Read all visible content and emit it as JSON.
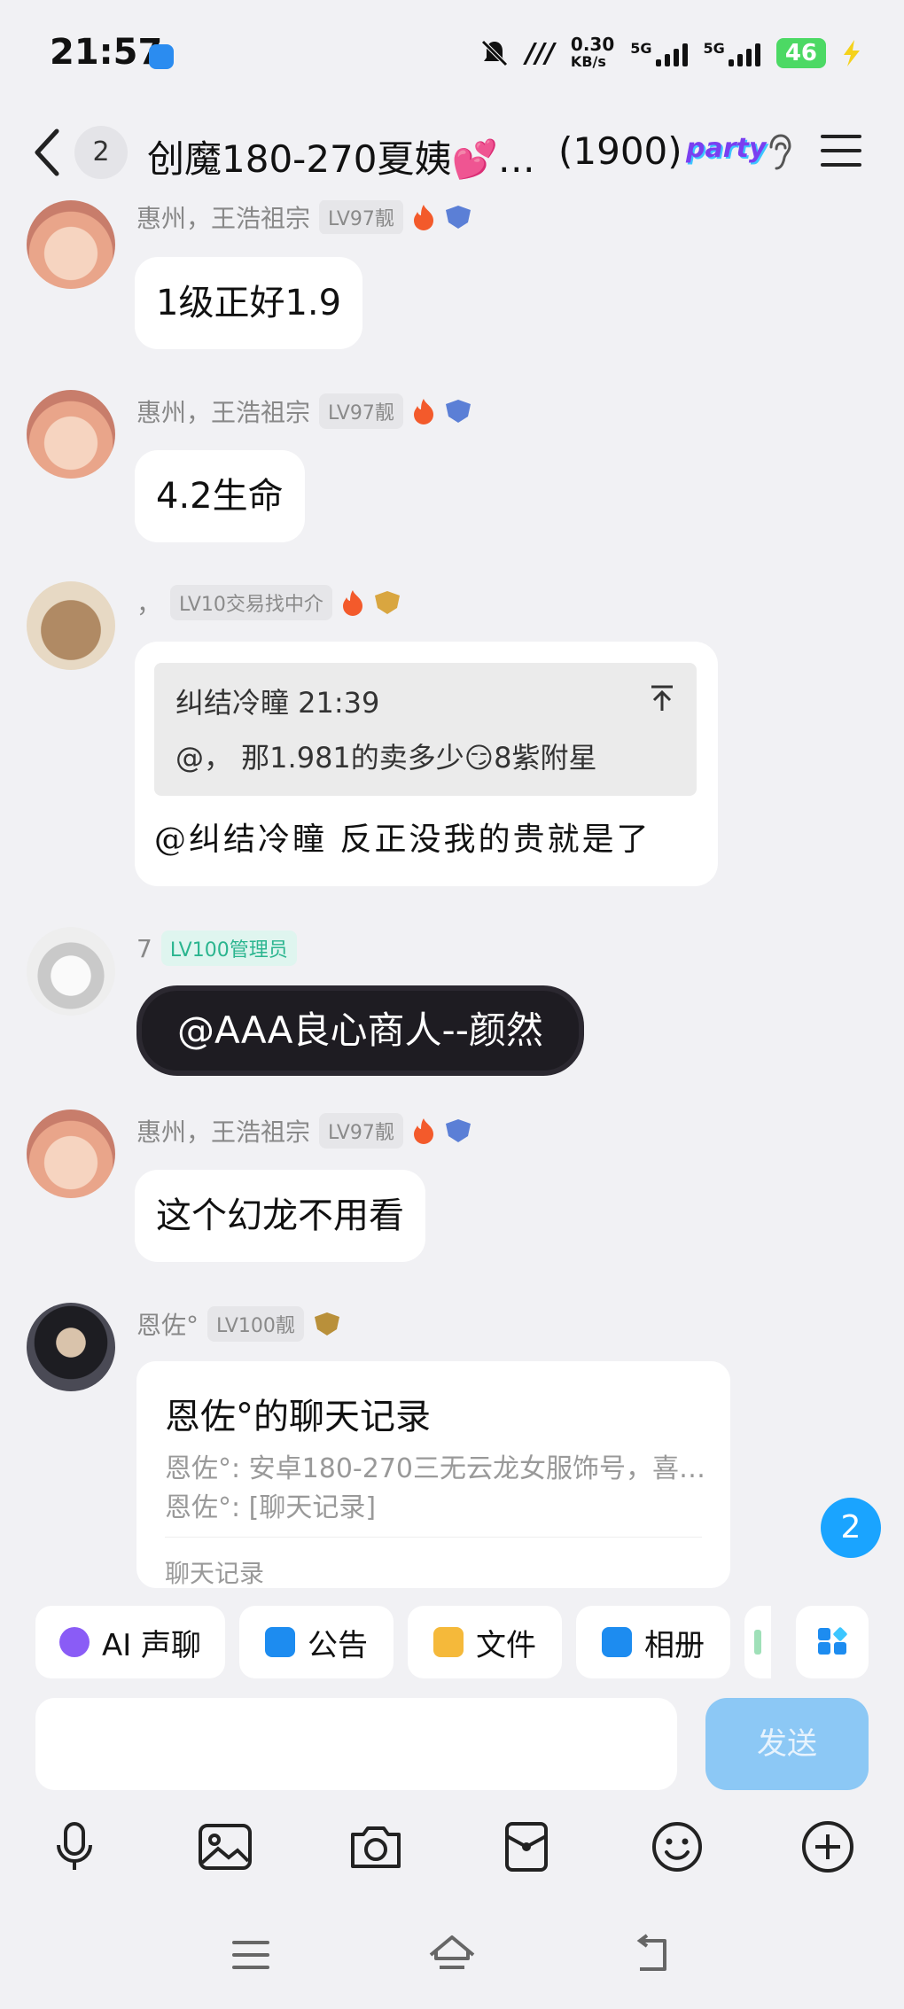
{
  "status_bar": {
    "time": "21:57",
    "net_speed": "0.30",
    "net_unit": "KB/s",
    "sim1": "5G",
    "sim2": "5G",
    "battery": "46"
  },
  "header": {
    "back_count": "2",
    "title": "创魔180-270夏姨💕…",
    "member_count": "(1900)",
    "brand_badge": "party"
  },
  "messages": [
    {
      "sender": "惠州，王浩祖宗",
      "level": "LV97靓",
      "text": "1级正好1.9"
    },
    {
      "sender": "惠州，王浩祖宗",
      "level": "LV97靓",
      "text": "4.2生命"
    },
    {
      "sender": "，",
      "level": "LV10交易找中介",
      "quote_author_time": "纠结冷瞳 21:39",
      "quote_text": "@，  那1.981的卖多少😏8紫附星",
      "reply_text": "@纠结冷瞳 反正没我的贵就是了"
    },
    {
      "sender": "7",
      "level": "LV100管理员",
      "text": "@AAA良心商人--颜然"
    },
    {
      "sender": "惠州，王浩祖宗",
      "level": "LV97靓",
      "text": "这个幻龙不用看"
    },
    {
      "sender": "恩佐°",
      "level": "LV100靓",
      "card_title": "恩佐°的聊天记录",
      "card_line1": "恩佐°: 安卓180-270三无云龙女服饰号，喜…",
      "card_line2": "恩佐°: [聊天记录]",
      "card_footer": "聊天记录"
    }
  ],
  "unread_count": "2",
  "toolbar": [
    {
      "label": "AI 声聊",
      "icon": "voice-chat-icon",
      "color": "#8a5cf6"
    },
    {
      "label": "公告",
      "icon": "announcement-icon",
      "color": "#1d8cf0"
    },
    {
      "label": "文件",
      "icon": "folder-icon",
      "color": "#f5b93a"
    },
    {
      "label": "相册",
      "icon": "album-icon",
      "color": "#1d8cf0"
    }
  ],
  "input": {
    "placeholder": "",
    "send_label": "发送"
  },
  "bottom_icons": [
    "microphone-icon",
    "image-icon",
    "camera-icon",
    "red-packet-icon",
    "emoji-icon",
    "plus-icon"
  ]
}
